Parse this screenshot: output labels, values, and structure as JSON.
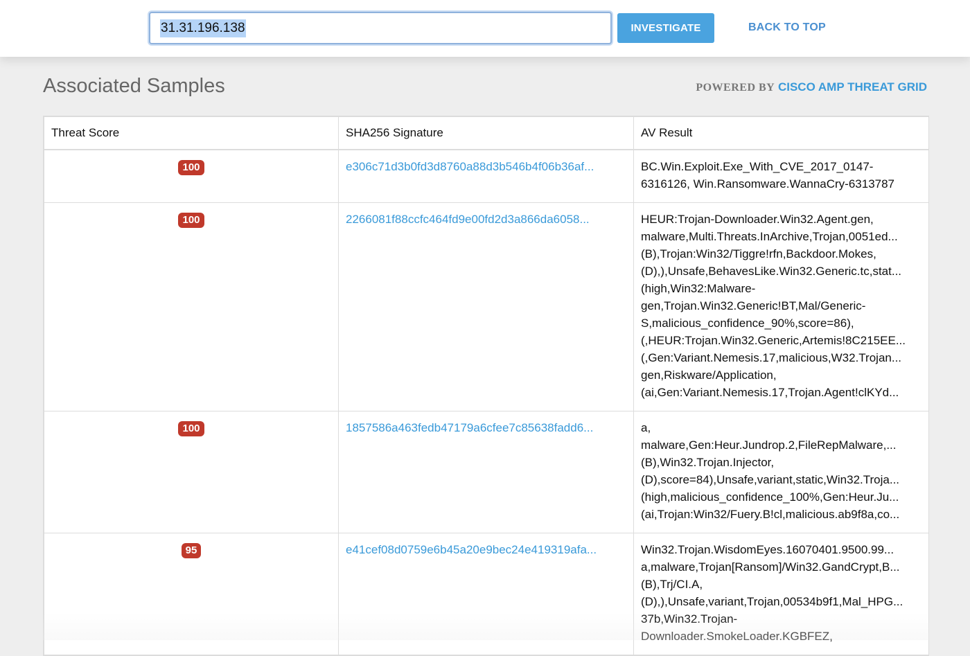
{
  "search": {
    "value": "31.31.196.138"
  },
  "header": {
    "investigate_label": "INVESTIGATE",
    "back_to_top_label": "BACK TO TOP"
  },
  "section": {
    "title": "Associated Samples",
    "powered_by": "POWERED BY",
    "brand": "CISCO AMP THREAT GRID"
  },
  "table": {
    "columns": [
      "Threat Score",
      "SHA256 Signature",
      "AV Result"
    ],
    "rows": [
      {
        "score": "100",
        "sha": "e306c71d3b0fd3d8760a88d3b546b4f06b36af...",
        "av": [
          "BC.Win.Exploit.Exe_With_CVE_2017_0147-",
          "6316126, Win.Ransomware.WannaCry-6313787"
        ]
      },
      {
        "score": "100",
        "sha": "2266081f88ccfc464fd9e00fd2d3a866da6058...",
        "av": [
          "HEUR:Trojan-Downloader.Win32.Agent.gen,",
          "malware,Multi.Threats.InArchive,Trojan,0051ed...",
          "(B),Trojan:Win32/Tiggre!rfn,Backdoor.Mokes,",
          "(D),),Unsafe,BehavesLike.Win32.Generic.tc,stat...",
          "(high,Win32:Malware-",
          "gen,Trojan.Win32.Generic!BT,Mal/Generic-",
          "S,malicious_confidence_90%,score=86),",
          "(,HEUR:Trojan.Win32.Generic,Artemis!8C215EE...",
          "(,Gen:Variant.Nemesis.17,malicious,W32.Trojan...",
          "gen,Riskware/Application,",
          "(ai,Gen:Variant.Nemesis.17,Trojan.Agent!clKYd..."
        ]
      },
      {
        "score": "100",
        "sha": "1857586a463fedb47179a6cfee7c85638fadd6...",
        "av": [
          "a,",
          "malware,Gen:Heur.Jundrop.2,FileRepMalware,...",
          "(B),Win32.Trojan.Injector,",
          "(D),score=84),Unsafe,variant,static,Win32.Troja...",
          "(high,malicious_confidence_100%,Gen:Heur.Ju...",
          "(ai,Trojan:Win32/Fuery.B!cl,malicious.ab9f8a,co..."
        ]
      },
      {
        "score": "95",
        "sha": "e41cef08d0759e6b45a20e9bec24e419319afa...",
        "av": [
          "Win32.Trojan.WisdomEyes.16070401.9500.99...",
          "a,malware,Trojan[Ransom]/Win32.GandCrypt,B...",
          "(B),Trj/CI.A,",
          "(D),),Unsafe,variant,Trojan,00534b9f1,Mal_HPG...",
          "37b,Win32.Trojan-",
          "Downloader.SmokeLoader.KGBFEZ,"
        ]
      }
    ]
  },
  "colors": {
    "accent": "#4aa3df",
    "link": "#3a9ad9",
    "badge": "#c0392b",
    "background": "#eeeeee"
  }
}
